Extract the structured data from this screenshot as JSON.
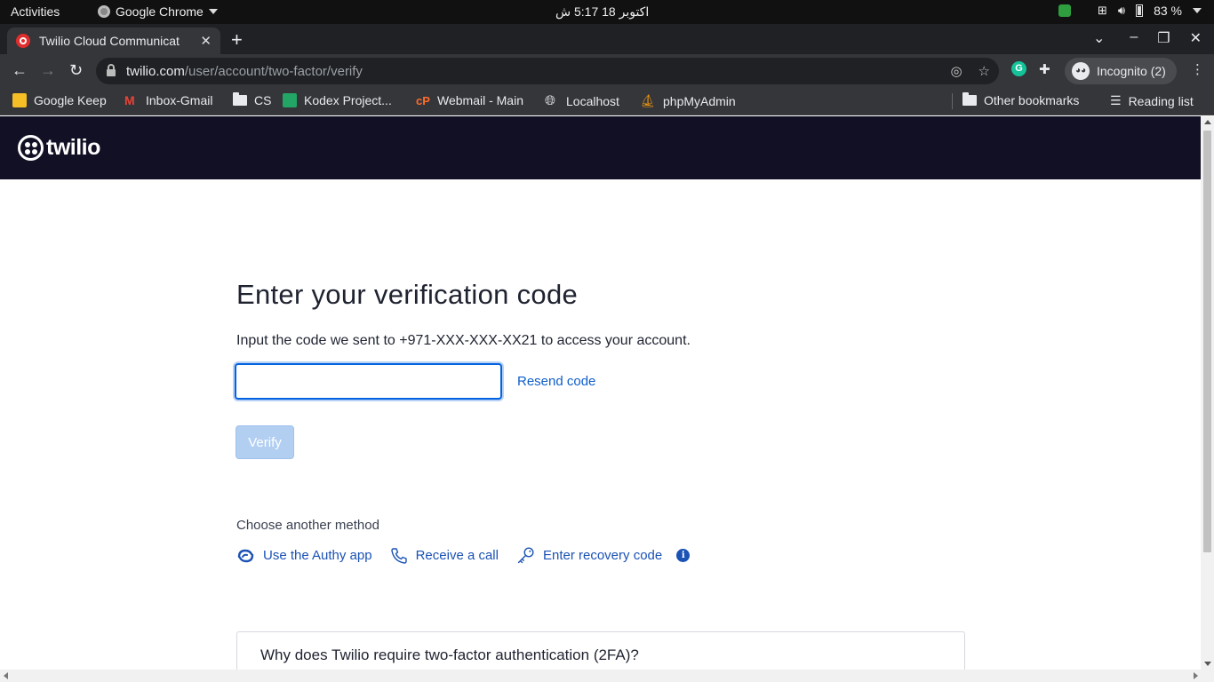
{
  "system_bar": {
    "activities": "Activities",
    "app_name": "Google Chrome",
    "clock": "اكتوبر 18  5:17 ش",
    "battery": "83 %"
  },
  "browser": {
    "tab_title": "Twilio Cloud Communicat",
    "url_host": "twilio.com",
    "url_path": "/user/account/two-factor/verify",
    "profile": "Incognito (2)"
  },
  "bookmarks": [
    {
      "label": "Google Keep",
      "icon": "google-keep-icon",
      "color": "#f6bf26"
    },
    {
      "label": "Inbox-Gmail",
      "icon": "gmail-icon",
      "color": "#ea4335"
    },
    {
      "label": "CS",
      "icon": "folder-icon",
      "color": "#e8eaed"
    },
    {
      "label": "Kodex Project...",
      "icon": "sheets-icon",
      "color": "#23a566"
    },
    {
      "label": "Webmail - Main",
      "icon": "cpanel-icon",
      "color": "#ff6c2c"
    },
    {
      "label": "Localhost",
      "icon": "globe-icon",
      "color": "#e8eaed"
    },
    {
      "label": "phpMyAdmin",
      "icon": "phpmyadmin-icon",
      "color": "#f89c0e"
    }
  ],
  "bookmarks_right": {
    "other": "Other bookmarks",
    "reading": "Reading list"
  },
  "twilio": {
    "logo_text": "twilio",
    "header_bg": "#121024",
    "heading": "Enter your verification code",
    "instructions": "Input the code we sent to +971-XXX-XXX-XX21 to access your account.",
    "code_value": "",
    "resend_label": "Resend code",
    "verify_label": "Verify",
    "choose_label": "Choose another method",
    "methods": [
      {
        "label": "Use the Authy app",
        "icon": "authy-icon"
      },
      {
        "label": "Receive a call",
        "icon": "phone-icon"
      },
      {
        "label": "Enter recovery code",
        "icon": "key-icon"
      }
    ],
    "info_glyph": "i",
    "faq_question": "Why does Twilio require two-factor authentication (2FA)?",
    "link_color": "#1b52b5",
    "focus_color": "#0263e0"
  }
}
